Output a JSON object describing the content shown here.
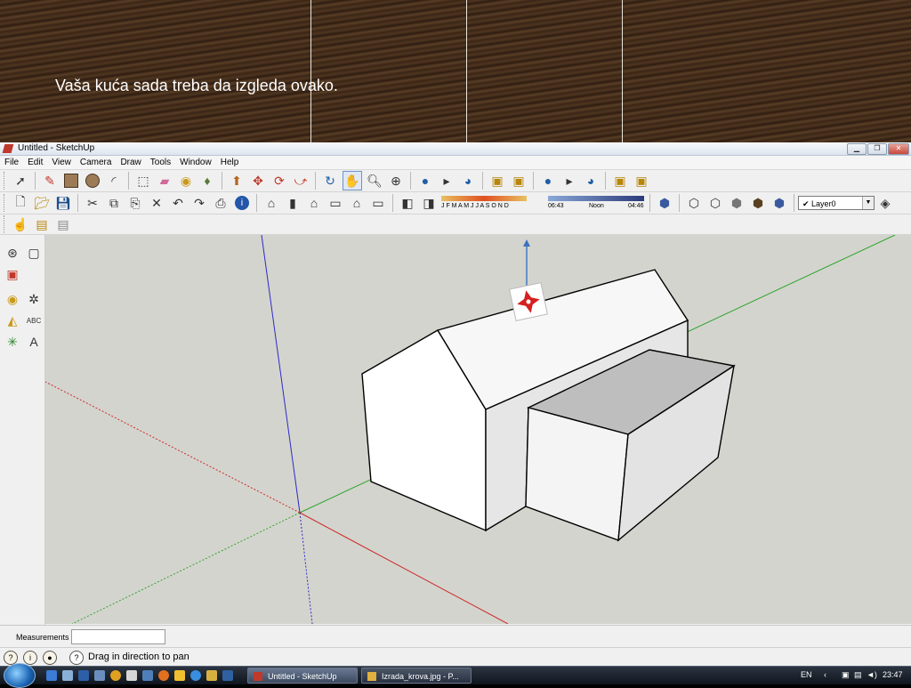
{
  "slide": {
    "caption": "Vaša kuća sada treba da izgleda ovako."
  },
  "window": {
    "title": "Untitled - SketchUp",
    "controls": [
      "minimize-icon",
      "maximize-icon",
      "close-icon"
    ]
  },
  "menu": [
    "File",
    "Edit",
    "View",
    "Camera",
    "Draw",
    "Tools",
    "Window",
    "Help"
  ],
  "toolbar": {
    "shadow_months": "J F M A M J J A S O N D",
    "shadow_time_start": "06:43",
    "shadow_time_mid": "Noon",
    "shadow_time_end": "04:46",
    "layer": "Layer0"
  },
  "measurements": {
    "label": "Measurements",
    "value": ""
  },
  "status": {
    "message": "Drag in direction to pan"
  },
  "taskbar": {
    "tasks": [
      {
        "label": "Untitled - SketchUp",
        "active": true
      },
      {
        "label": "Izrada_krova.jpg - P...",
        "active": false
      }
    ],
    "language": "EN",
    "clock": "23:47"
  },
  "colors": {
    "axis_red": "#cc2b2b",
    "axis_green": "#2fa52f",
    "axis_blue": "#2b2bc8",
    "viewport_bg": "#d4d4ce",
    "roof_gray": "#bebebe"
  }
}
